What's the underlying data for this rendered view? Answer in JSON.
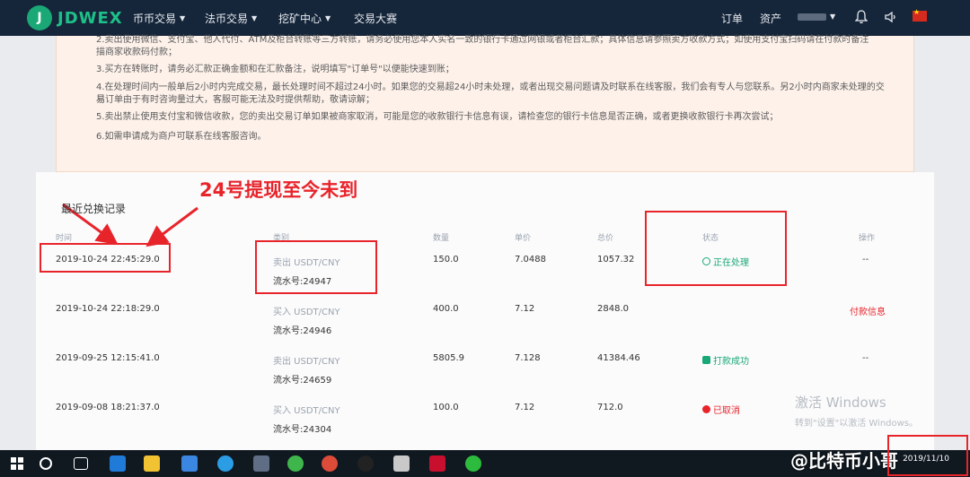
{
  "nav": {
    "logo_text": "JDWEX",
    "items": [
      "币币交易",
      "法币交易",
      "挖矿中心",
      "交易大赛"
    ],
    "orders": "订单",
    "assets": "资产"
  },
  "notice": {
    "lines": [
      "2.卖出使用微信、支付宝、他人代付、ATM及柜台转账等三方转账，请务必使用您本人实名一致的银行卡通过网银或者柜台汇款；具体信息请参照卖方收款方式；如使用支付宝扫码请在付款时备注",
      "描商家收款码付款；",
      "3.买方在转账时，请务必汇款正确金额和在汇款备注，说明填写\"订单号\"以便能快速到账；",
      "4.在处理时间内一般单后2小时内完成交易，最长处理时间不超过24小时。如果您的交易超24小时未处理，或者出现交易问题请及时联系在线客服，我们会有专人与您联系。另2小时内商家未处理的交易",
      "易订单由于有时咨询量过大，客服可能无法及时提供帮助，敬请谅解；",
      "5.卖出禁止使用支付宝和微信收款，您的卖出交易订单如果被商家取消，可能是您的收款银行卡信息有误，请检查您的银行卡信息是否正确，或者更换收款银行卡再次尝试；",
      "6.如需申请成为商户可联系在线客服咨询。"
    ]
  },
  "annotation": "24号提现至今未到",
  "records": {
    "title": "最近兑换记录",
    "headers": [
      "时间",
      "类别",
      "数量",
      "单价",
      "总价",
      "状态",
      "操作"
    ],
    "rows": [
      {
        "time": "2019-10-24 22:45:29.0",
        "type": "卖出 USDT/CNY",
        "serial": "流水号:24947",
        "qty": "150.0",
        "price": "7.0488",
        "total": "1057.32",
        "status": "正在处理",
        "action": "--"
      },
      {
        "time": "2019-10-24 22:18:29.0",
        "type": "买入 USDT/CNY",
        "serial": "流水号:24946",
        "qty": "400.0",
        "price": "7.12",
        "total": "2848.0",
        "status": "",
        "action": "付款信息"
      },
      {
        "time": "2019-09-25 12:15:41.0",
        "type": "卖出 USDT/CNY",
        "serial": "流水号:24659",
        "qty": "5805.9",
        "price": "7.128",
        "total": "41384.46",
        "status": "打款成功",
        "action": "--"
      },
      {
        "time": "2019-09-08 18:21:37.0",
        "type": "买入 USDT/CNY",
        "serial": "流水号:24304",
        "qty": "100.0",
        "price": "7.12",
        "total": "712.0",
        "status": "已取消",
        "action": "--"
      }
    ]
  },
  "watermark": {
    "line1": "激活 Windows",
    "line2": "转到\"设置\"以激活 Windows。"
  },
  "overlay": {
    "weibo": "@比特币小哥"
  },
  "clock": {
    "date": "2019/11/10"
  },
  "colors": {
    "processing": "#1aa876",
    "success": "#1aa876",
    "cancelled": "#e8242b",
    "payinfo": "#e8242b",
    "annotation_red": "#e8242b"
  }
}
